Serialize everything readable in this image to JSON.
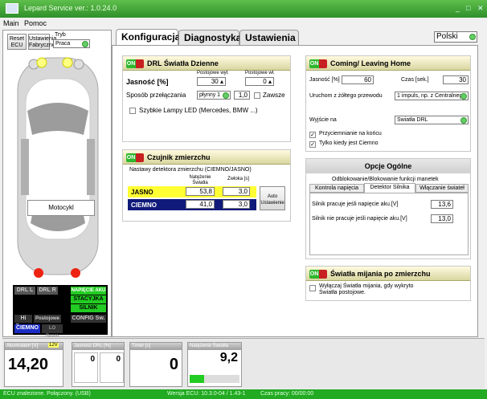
{
  "window": {
    "title": "Lepard Service ver.: 1.0.24.0"
  },
  "menu": [
    "Main",
    "Pomoc"
  ],
  "sidebar": {
    "reset_label": "Reset ECU",
    "factory_label": "Ustawienia Fabryczne",
    "mode_label": "Tryb",
    "mode_value": "Praca",
    "car_label": "Motocykl",
    "indicators": {
      "drl_l": "DRL L",
      "drl_r": "DRL R",
      "napiecie": "NAPIĘCIE AKU",
      "stacyjka": "STACYJKA",
      "silnik": "SILNIK",
      "hi_beam": "Hi Beam",
      "postojowe": "Postojowe",
      "config": "CONFIG Sw.",
      "ciemno": "CIEMNO",
      "lo_beam": "LO Beam"
    }
  },
  "tabs": [
    "Konfiguracja",
    "Diagnostyka",
    "Ustawienia"
  ],
  "language": "Polski",
  "drl": {
    "title": "DRL Światła Dzienne",
    "brightness_label": "Jasność [%]",
    "col1": "Postojowe wył.",
    "col2": "Postojowe wł.",
    "val1": "30",
    "val2": "0",
    "switch_label": "Sposób przełączania",
    "switch_value": "płynny 1",
    "switch_num": "1,0",
    "always_label": "Zawsze",
    "led_label": "Szybkie Lampy LED (Mercedes, BMW ...)"
  },
  "sensor": {
    "title": "Czujnik zmierzchu",
    "desc": "Nastawy detektora zmierzchu (CIEMNO/JASNO)",
    "col1": "Natężenie Światła",
    "col2": "Zwłoka [s]",
    "rows": [
      {
        "label": "JASNO",
        "v1": "53,8",
        "v2": "3,0"
      },
      {
        "label": "CIEMNO",
        "v1": "41,0",
        "v2": "3,0"
      }
    ],
    "auto_label": "Auto Ustawienie"
  },
  "coming": {
    "title": "Coming/ Leaving Home",
    "brightness_label": "Jasność [%]",
    "brightness_value": "60",
    "time_label": "Czas [sek.]",
    "time_value": "30",
    "trigger_label": "Uruchom z żółtego przewodu",
    "trigger_value": "1 impuls, np. z Centralnego",
    "output_label": "Wyjście na",
    "output_value": "Światła DRL",
    "dim_label": "Przyciemnianie na końcu",
    "dark_label": "Tylko kiedy jest Ciemno"
  },
  "general": {
    "title": "Opcje Ogólne",
    "header": "Odblokowanie/Blokowanie funkcji manetek",
    "tabs": [
      "Kontrola napięcia",
      "Detektor Silnika",
      "Włączanie świateł"
    ],
    "row1_label": "Silnik pracuje jeśli napięcie aku.[V]",
    "row1_value": "13,6",
    "row2_label": "Silnik nie pracuje jeśli napięcie aku.[V]",
    "row2_value": "13,0"
  },
  "lowbeam": {
    "title": "Światła mijania po zmierzchu",
    "check_label": "Wyłączaj Światła mijania, gdy wykryto Światła postojowe."
  },
  "gauges": {
    "voltage": {
      "label": "Akumulator [V]",
      "badge": "12V",
      "value": "14,20"
    },
    "brightness": {
      "label": "Jasność DRL [%]",
      "v1": "0",
      "v2": "0"
    },
    "timer": {
      "label": "Timer [s]",
      "value": "0"
    },
    "light": {
      "label": "Natężenie Światła",
      "value": "9,2",
      "level": 0.29
    }
  },
  "status": {
    "connection": "ECU znalezione. Połączony. (USB)",
    "version": "Wersja ECU: 10.3.0-04 / 1.43-1",
    "worktime": "Czas pracy: 00/00:00"
  },
  "colors": {
    "accent": "#2eb82e",
    "title": "#2f8f2a"
  }
}
